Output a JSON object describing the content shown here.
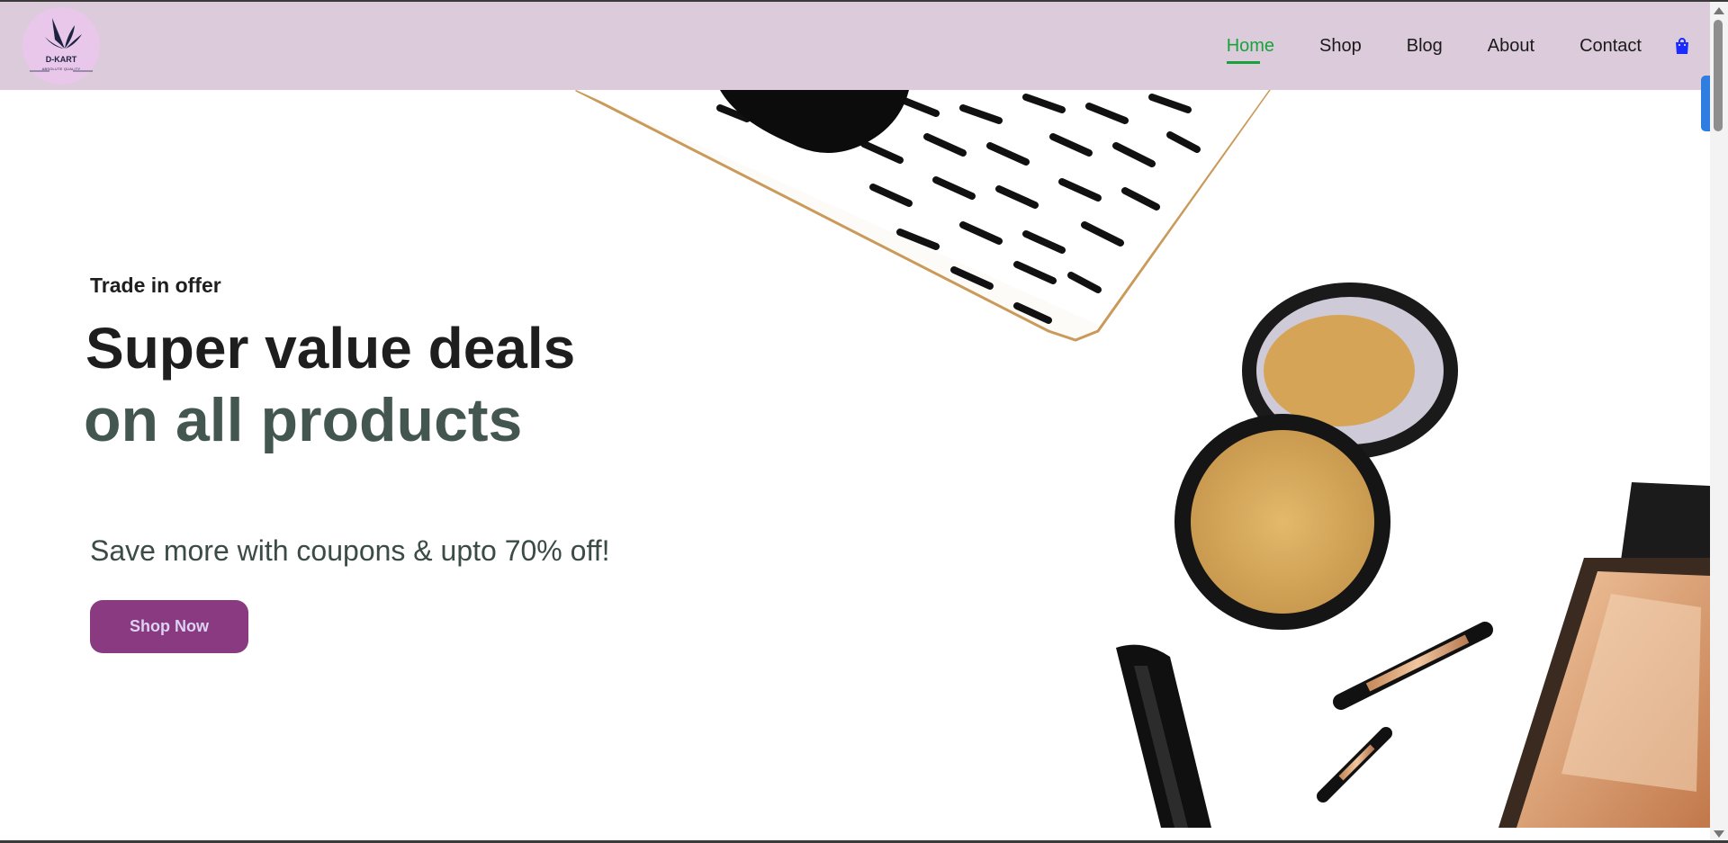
{
  "brand": {
    "name": "D-KART",
    "tagline": "ABSOLUTE QUALITY"
  },
  "nav": {
    "items": [
      {
        "label": "Home",
        "active": true
      },
      {
        "label": "Shop",
        "active": false
      },
      {
        "label": "Blog",
        "active": false
      },
      {
        "label": "About",
        "active": false
      },
      {
        "label": "Contact",
        "active": false
      }
    ],
    "cart_icon": "shopping-bag-icon"
  },
  "hero": {
    "eyebrow": "Trade in offer",
    "headline_line1": "Super value deals",
    "headline_line2": "on all products",
    "subtext": "Save more with coupons & upto 70% off!",
    "button_label": "Shop Now"
  },
  "colors": {
    "header_bg": "#dccbdb",
    "active_nav": "#17a33a",
    "headline_accent": "#435650",
    "button_bg": "#8a3a80",
    "cart_icon": "#1a2cff"
  }
}
